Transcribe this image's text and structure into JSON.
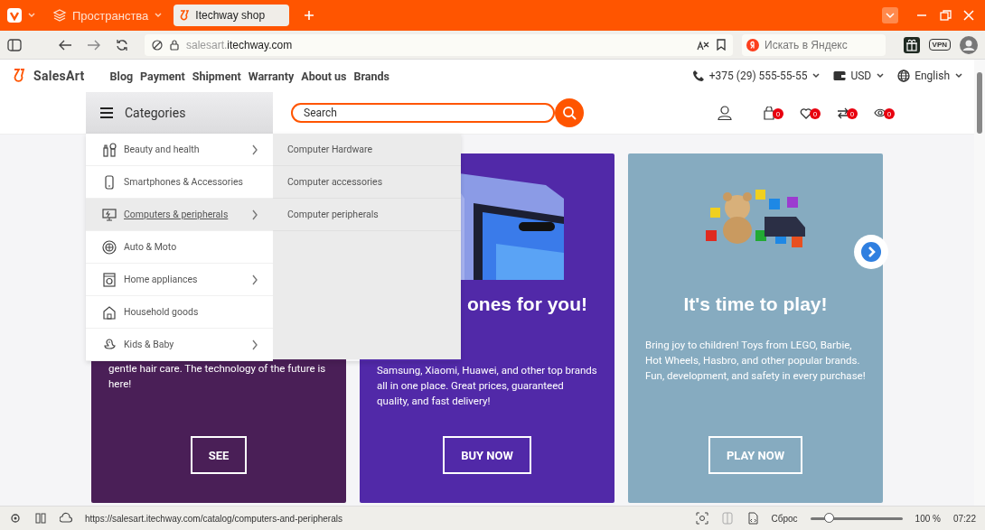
{
  "browser": {
    "workspaces": "Пространства",
    "tabs": [
      {
        "title": "Itechway shop",
        "selected": true
      }
    ],
    "url": {
      "subdomain": "salesart.",
      "domain": "itechway.com"
    },
    "search_placeholder": "Искать в Яндекс",
    "vpn_label": "VPN"
  },
  "header": {
    "logo": "SalesArt",
    "nav": [
      "Blog",
      "Payment",
      "Shipment",
      "Warranty",
      "About us",
      "Brands"
    ],
    "phone": "+375 (29) 555-55-55",
    "currency": "USD",
    "language": "English"
  },
  "toolbar": {
    "categories_label": "Categories",
    "search_placeholder": "Search",
    "counters": [
      {
        "kind": "cart",
        "count": "0"
      },
      {
        "kind": "wishlist",
        "count": "0"
      },
      {
        "kind": "compare",
        "count": "0"
      },
      {
        "kind": "viewed",
        "count": "0"
      }
    ]
  },
  "categories": {
    "items": [
      {
        "kind": "beauty",
        "label": "Beauty and health",
        "has_submenu": true,
        "selected": false
      },
      {
        "kind": "phone",
        "label": "Smartphones & Accessories",
        "has_submenu": false,
        "selected": false
      },
      {
        "kind": "computer",
        "label": "Computers & peripherals",
        "has_submenu": true,
        "selected": true
      },
      {
        "kind": "auto",
        "label": "Auto & Moto",
        "has_submenu": false,
        "selected": false
      },
      {
        "kind": "appliance",
        "label": "Home appliances",
        "has_submenu": true,
        "selected": false
      },
      {
        "kind": "house",
        "label": "Household goods",
        "has_submenu": false,
        "selected": false
      },
      {
        "kind": "kids",
        "label": "Kids & Baby",
        "has_submenu": true,
        "selected": false
      }
    ],
    "submenu": [
      "Computer Hardware",
      "Computer accessories",
      "Computer peripherals"
    ]
  },
  "cards": [
    {
      "color": "#4a1f57",
      "description": "gentle hair care. The technology of the future is here!",
      "button": "SEE"
    },
    {
      "color": "#5129a8",
      "title": "ones for you!",
      "description": "Samsung, Xiaomi, Huawei, and other top brands all in one place. Great prices, guaranteed quality, and fast delivery!",
      "button": "BUY NOW"
    },
    {
      "color": "#86abc0",
      "title": "It's time to play!",
      "description": "Bring joy to children! Toys from LEGO, Barbie, Hot Wheels, Hasbro, and other popular brands. Fun, development, and safety in every purchase!",
      "button": "PLAY NOW"
    }
  ],
  "status_bar": {
    "url": "https://salesart.itechway.com/catalog/computers-and-peripherals",
    "reset": "Сброс",
    "zoom": {
      "level": 0.2,
      "reading": "100 %"
    },
    "time": "07:22"
  }
}
